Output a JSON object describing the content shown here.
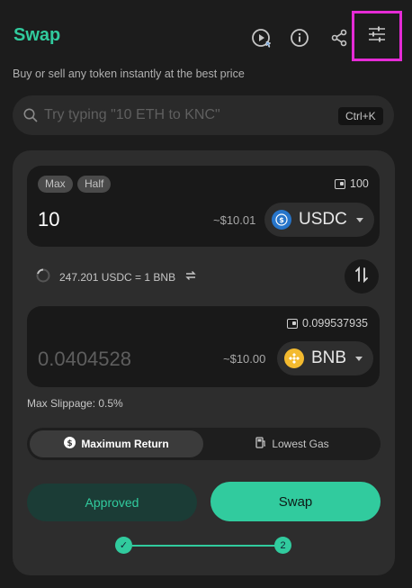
{
  "header": {
    "title": "Swap",
    "subtitle": "Buy or sell any token instantly at the best price",
    "icons": [
      "play-guide-icon",
      "info-icon",
      "share-icon",
      "settings-sliders-icon"
    ]
  },
  "search": {
    "placeholder": "Try typing \"10 ETH to KNC\"",
    "value": "",
    "shortcut": "Ctrl+K"
  },
  "input_token": {
    "max_label": "Max",
    "half_label": "Half",
    "balance": "100",
    "amount": "10",
    "usd_value": "~$10.01",
    "symbol": "USDC",
    "color": "#2775ca"
  },
  "rate": {
    "text": "247.201 USDC = 1 BNB"
  },
  "output_token": {
    "balance": "0.099537935",
    "amount": "0.0404528",
    "usd_value": "~$10.00",
    "symbol": "BNB",
    "color": "#f3ba2f"
  },
  "slippage": {
    "text": "Max Slippage: 0.5%"
  },
  "route_modes": {
    "selected": "Maximum Return",
    "options": [
      "Maximum Return",
      "Lowest Gas"
    ]
  },
  "actions": {
    "approved_label": "Approved",
    "swap_label": "Swap"
  },
  "progress": {
    "step1": "✓",
    "step2": "2"
  },
  "colors": {
    "accent": "#31cb9e",
    "highlight": "#e52bd6"
  }
}
